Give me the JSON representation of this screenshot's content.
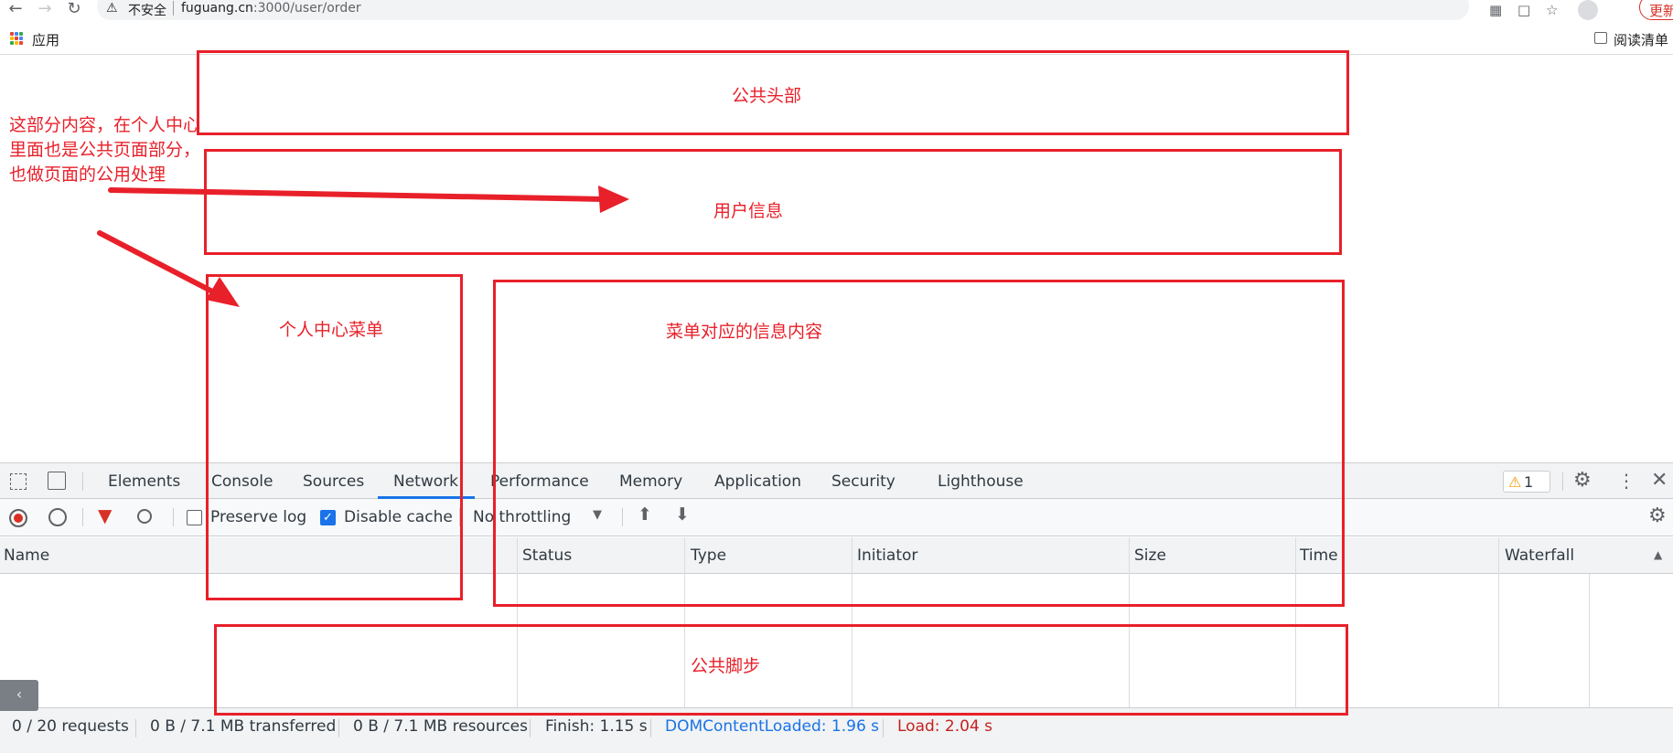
{
  "browser": {
    "url_host": "fuguang.cn",
    "url_path": ":3000/user/order",
    "security_label": "不安全",
    "update_label": "更新",
    "bookmarks": {
      "apps_label": "应用",
      "reading_list_label": "阅读清单"
    }
  },
  "annotations": {
    "header_label": "公共头部",
    "userinfo_label": "用户信息",
    "menu_label": "个人中心菜单",
    "content_label": "菜单对应的信息内容",
    "footer_label": "公共脚步",
    "note_lines": [
      "这部分内容，在个人中心",
      "里面也是公共页面部分，",
      "也做页面的公用处理"
    ],
    "color": "#e8202a"
  },
  "devtools": {
    "tabs": [
      "Elements",
      "Console",
      "Sources",
      "Network",
      "Performance",
      "Memory",
      "Application",
      "Security",
      "Lighthouse"
    ],
    "active_tab": "Network",
    "warning_count": "1",
    "controls": {
      "preserve_log_label": "Preserve log",
      "preserve_log_checked": false,
      "disable_cache_label": "Disable cache",
      "disable_cache_checked": true,
      "throttling_value": "No throttling"
    },
    "columns": [
      "Name",
      "Status",
      "Type",
      "Initiator",
      "Size",
      "Time",
      "Waterfall"
    ],
    "status_bar": {
      "requests": "0 / 20 requests",
      "transferred": "0 B / 7.1 MB transferred",
      "resources": "0 B / 7.1 MB resources",
      "finish": "Finish: 1.15 s",
      "dom_content_loaded": "DOMContentLoaded: 1.96 s",
      "load": "Load: 2.04 s"
    },
    "colors": {
      "dom_content_loaded": "#1a73e8",
      "load": "#c5221f",
      "accent": "#1a73e8"
    }
  }
}
